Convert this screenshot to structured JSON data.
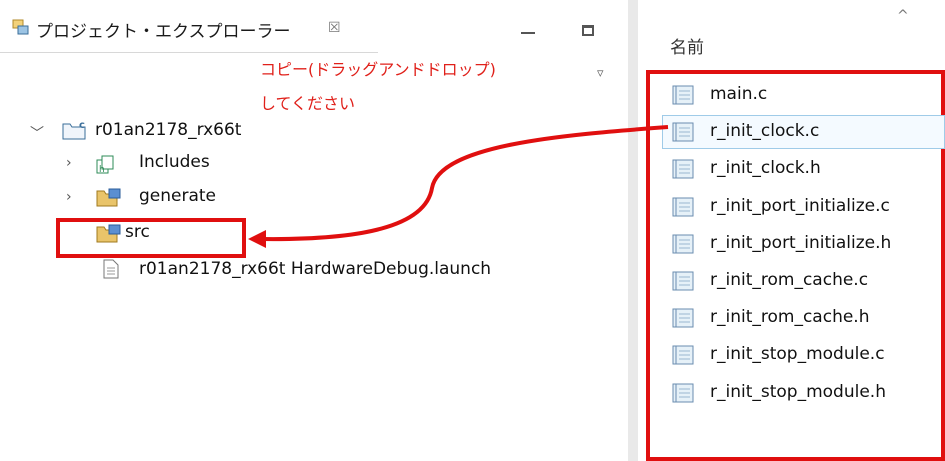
{
  "explorer": {
    "tab_title": "プロジェクト・エクスプローラー",
    "tab_close": "☒",
    "note_line1": "コピー(ドラッグアンドドロップ)",
    "note_line2": "してください",
    "tree": {
      "project": "r01an2178_rx66t",
      "includes": "Includes",
      "generate": "generate",
      "src": "src",
      "launch": "r01an2178_rx66t HardwareDebug.launch"
    }
  },
  "files": {
    "column_header": "名前",
    "items": [
      "main.c",
      "r_init_clock.c",
      "r_init_clock.h",
      "r_init_port_initialize.c",
      "r_init_port_initialize.h",
      "r_init_rom_cache.c",
      "r_init_rom_cache.h",
      "r_init_stop_module.c",
      "r_init_stop_module.h"
    ],
    "selected_index": 1
  },
  "colors": {
    "highlight": "#e00f0f",
    "note_text": "#e0201a",
    "selection": "#9fcbe8"
  }
}
